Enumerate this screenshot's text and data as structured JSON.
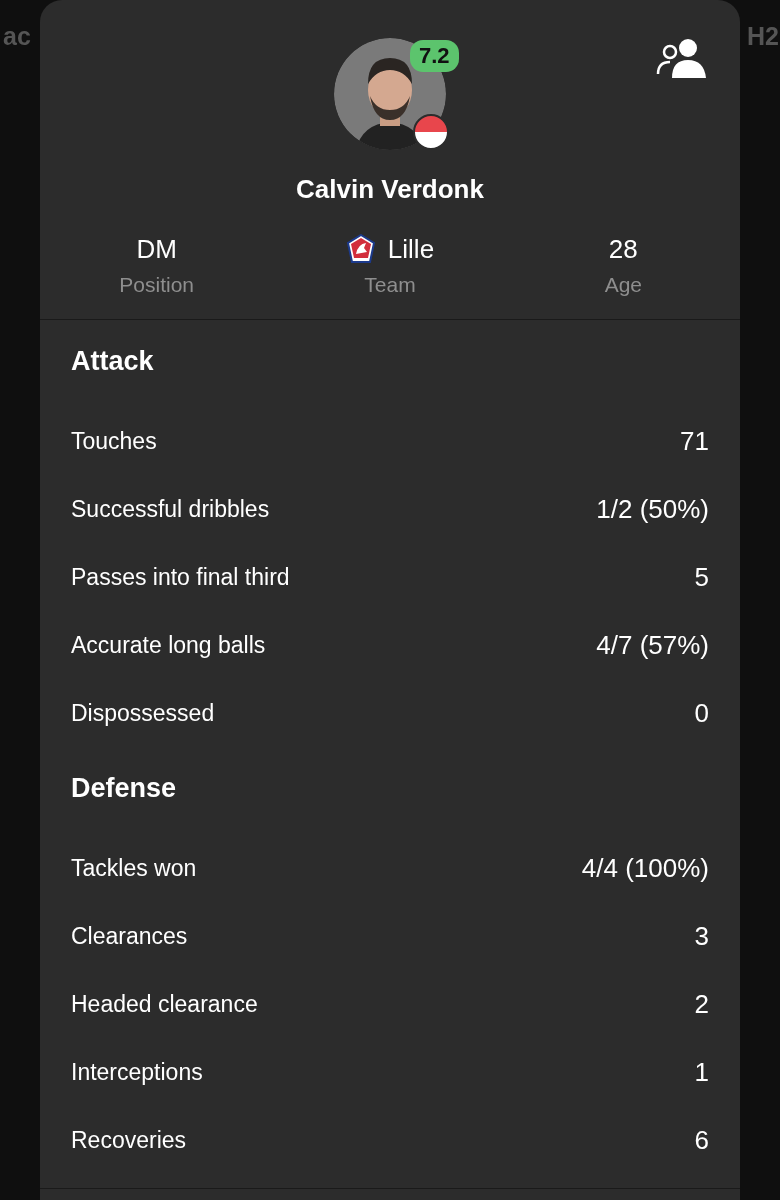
{
  "background_tabs": [
    {
      "label": "ac"
    },
    {
      "label": "H2"
    }
  ],
  "player": {
    "name": "Calvin Verdonk",
    "rating": "7.2"
  },
  "info": [
    {
      "kind": "text",
      "value": "DM",
      "label": "Position"
    },
    {
      "kind": "team",
      "value": "Lille",
      "label": "Team"
    },
    {
      "kind": "text",
      "value": "28",
      "label": "Age"
    }
  ],
  "sections": [
    {
      "title": "Attack",
      "rows": [
        {
          "label": "Touches",
          "value": "71"
        },
        {
          "label": "Successful dribbles",
          "value": "1/2 (50%)"
        },
        {
          "label": "Passes into final third",
          "value": "5"
        },
        {
          "label": "Accurate long balls",
          "value": "4/7 (57%)"
        },
        {
          "label": "Dispossessed",
          "value": "0"
        }
      ]
    },
    {
      "title": "Defense",
      "rows": [
        {
          "label": "Tackles won",
          "value": "4/4 (100%)"
        },
        {
          "label": "Clearances",
          "value": "3"
        },
        {
          "label": "Headed clearance",
          "value": "2"
        },
        {
          "label": "Interceptions",
          "value": "1"
        },
        {
          "label": "Recoveries",
          "value": "6"
        }
      ]
    }
  ]
}
